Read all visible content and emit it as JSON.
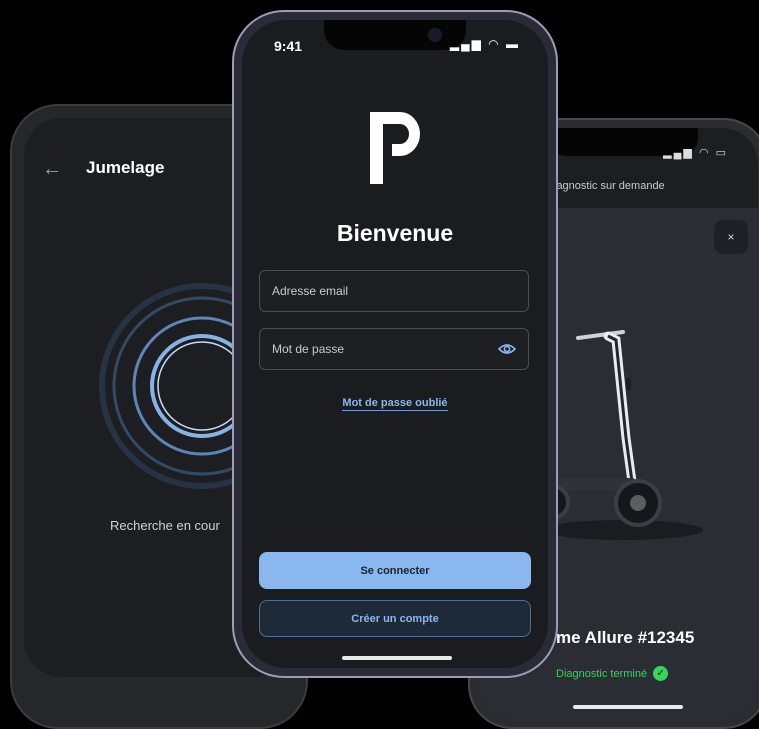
{
  "left_screen": {
    "back_icon": "arrow-left-icon",
    "title": "Jumelage",
    "search_text": "Recherche en cour"
  },
  "center_screen": {
    "status_time": "9:41",
    "status_icons": "signal wifi battery",
    "logo": "P logo",
    "welcome": "Bienvenue",
    "email_placeholder": "Adresse email",
    "password_placeholder": "Mot de passe",
    "password_icon": "eye-icon",
    "forgot_password": "Mot de passe oublié",
    "login_button": "Se connecter",
    "signup_button": "Créer un compte"
  },
  "right_screen": {
    "header": "iagnostic sur demande",
    "close_icon": "×",
    "product_name": "me Allure #12345",
    "diagnostic_status": "Diagnostic terminé",
    "status_color": "#35d45a"
  },
  "colors": {
    "accent": "#8ab8ee",
    "background": "#000000"
  }
}
